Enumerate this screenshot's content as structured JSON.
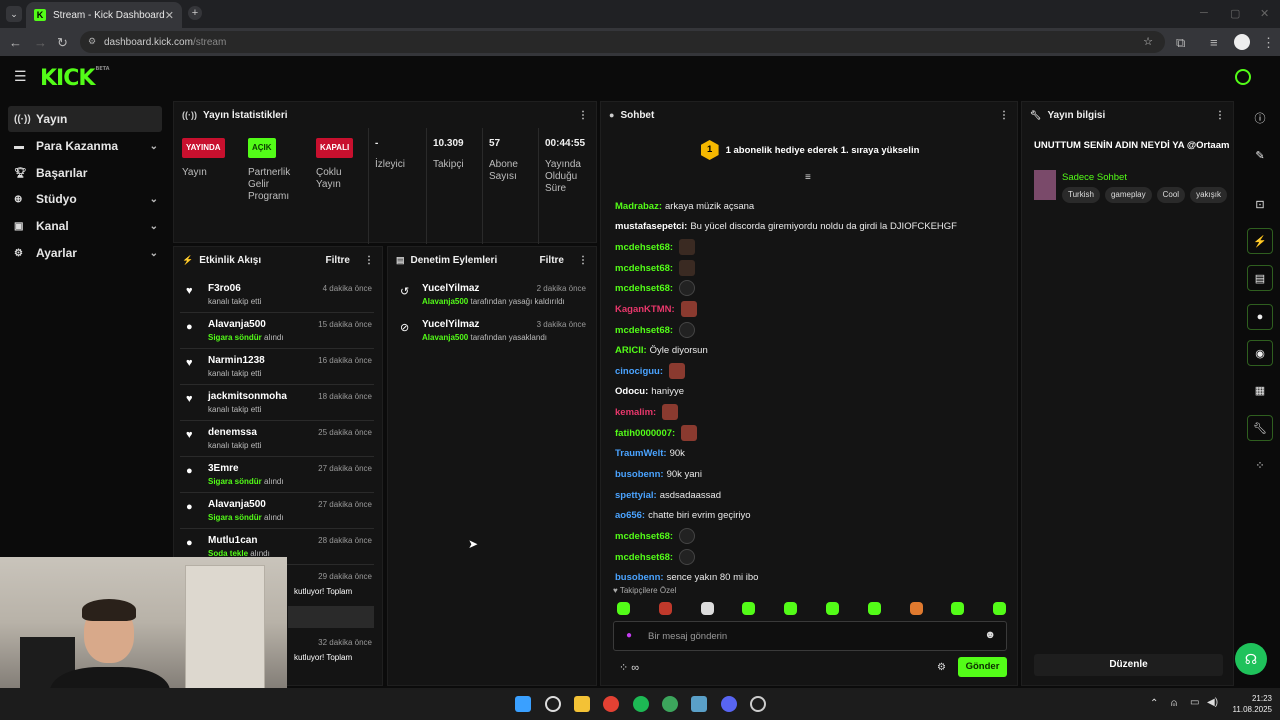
{
  "browser": {
    "tab_title": "Stream - Kick Dashboard",
    "url_host": "dashboard.kick.com",
    "url_path": "/stream"
  },
  "brand": {
    "logo": "KICK",
    "tag": "BETA",
    "accent": "#53fc18"
  },
  "sidebar": {
    "items": [
      {
        "label": "Yayın",
        "icon": "broadcast-icon"
      },
      {
        "label": "Para Kazanma",
        "icon": "dollar-icon"
      },
      {
        "label": "Başarılar",
        "icon": "trophy-icon"
      },
      {
        "label": "Stüdyo",
        "icon": "studio-icon"
      },
      {
        "label": "Kanal",
        "icon": "channel-icon"
      },
      {
        "label": "Ayarlar",
        "icon": "gear-icon"
      }
    ]
  },
  "stats": {
    "title": "Yayın İstatistikleri",
    "cells": [
      {
        "badge": "YAYINDA",
        "label": "Yayın"
      },
      {
        "badge": "AÇIK",
        "label": "Partnerlik Gelir Programı"
      },
      {
        "badge": "KAPALI",
        "label": "Çoklu Yayın"
      },
      {
        "value": "-",
        "label": "İzleyici"
      },
      {
        "value": "10.309",
        "label": "Takipçi"
      },
      {
        "value": "57",
        "label": "Abone Sayısı"
      },
      {
        "value": "00:44:55",
        "label": "Yayında Olduğu Süre"
      }
    ]
  },
  "activity": {
    "title": "Etkinlik Akışı",
    "filter": "Filtre",
    "items": [
      {
        "user": "F3ro06",
        "desc": "kanalı takip etti",
        "time": "4 dakika önce",
        "type": "follow"
      },
      {
        "user": "Alavanja500",
        "highlight": "Sigara söndür",
        "desc": "alındı",
        "time": "15 dakika önce",
        "type": "reward"
      },
      {
        "user": "Narmin1238",
        "desc": "kanalı takip etti",
        "time": "16 dakika önce",
        "type": "follow"
      },
      {
        "user": "jackmitsonmoha",
        "desc": "kanalı takip etti",
        "time": "18 dakika önce",
        "type": "follow"
      },
      {
        "user": "denemssa",
        "desc": "kanalı takip etti",
        "time": "25 dakika önce",
        "type": "follow"
      },
      {
        "user": "3Emre",
        "highlight": "Sigara söndür",
        "desc": "alındı",
        "time": "27 dakika önce",
        "type": "reward"
      },
      {
        "user": "Alavanja500",
        "highlight": "Sigara söndür",
        "desc": "alındı",
        "time": "27 dakika önce",
        "type": "reward"
      },
      {
        "user": "Mutlu1can",
        "highlight": "Soda tekle",
        "desc": "alındı",
        "time": "28 dakika önce",
        "type": "reward"
      }
    ],
    "partial": [
      {
        "text": "kutluyor! Toplam",
        "time": "29 dakika önce"
      },
      {
        "text": "kutluyor! Toplam",
        "time": "32 dakika önce"
      }
    ]
  },
  "moderation": {
    "title": "Denetim Eylemleri",
    "filter": "Filtre",
    "items": [
      {
        "user": "YucelYilmaz",
        "actor": "Alavanja500",
        "desc": "tarafından yasağı kaldırıldı",
        "time": "2 dakika önce"
      },
      {
        "user": "YucelYilmaz",
        "actor": "Alavanja500",
        "desc": "tarafından yasaklandı",
        "time": "3 dakika önce"
      }
    ]
  },
  "chat": {
    "title": "Sohbet",
    "banner_count": "1",
    "banner": "1 abonelik hediye ederek 1. sıraya yükselin",
    "messages": [
      {
        "user": "Madrabaz",
        "color": "#53fc18",
        "text": "arkaya müzik açsana"
      },
      {
        "user": "mustafasepetci",
        "color": "#ffffff",
        "text": "Bu yücel discorda giremiyordu noldu da girdi la DJIOFCKEHGF"
      },
      {
        "user": "mcdehset68",
        "color": "#53fc18",
        "text": ""
      },
      {
        "user": "mcdehset68",
        "color": "#53fc18",
        "text": ""
      },
      {
        "user": "mcdehset68",
        "color": "#53fc18",
        "text": ""
      },
      {
        "user": "KaganKTMN",
        "color": "#e8376b",
        "text": ""
      },
      {
        "user": "mcdehset68",
        "color": "#53fc18",
        "text": ""
      },
      {
        "user": "ARICII",
        "color": "#53fc18",
        "text": "Öyle diyorsun"
      },
      {
        "user": "cinociguu",
        "color": "#4aa3ff",
        "text": ""
      },
      {
        "user": "Odocu",
        "color": "#ffffff",
        "text": "haniyye"
      },
      {
        "user": "kemalim",
        "color": "#e8376b",
        "text": ""
      },
      {
        "user": "fatih0000007",
        "color": "#53fc18",
        "text": ""
      },
      {
        "user": "TraumWelt",
        "color": "#4aa3ff",
        "text": "90k"
      },
      {
        "user": "busobenn",
        "color": "#4aa3ff",
        "text": "90k yani"
      },
      {
        "user": "spettyial",
        "color": "#4aa3ff",
        "text": "asdsadaassad"
      },
      {
        "user": "ao656",
        "color": "#4aa3ff",
        "text": "chatte biri evrim geçiriyo"
      },
      {
        "user": "mcdehset68",
        "color": "#53fc18",
        "text": ""
      },
      {
        "user": "mcdehset68",
        "color": "#53fc18",
        "text": ""
      },
      {
        "user": "busobenn",
        "color": "#4aa3ff",
        "text": "sence yakın 80 mi ibo"
      }
    ],
    "followers_only": "Takipçilere Özel",
    "input_placeholder": "Bir mesaj gönderin",
    "send": "Gönder"
  },
  "stream_info": {
    "title": "Yayın bilgisi",
    "stream_title": "UNUTTUM SENİN ADIN NEYDİ YA @Ortaam",
    "category": "Sadece Sohbet",
    "tags": [
      "Turkish",
      "gameplay",
      "Cool",
      "yakışık"
    ],
    "edit": "Düzenle"
  },
  "taskbar": {
    "time": "21:23",
    "date": "11.08.2025"
  }
}
